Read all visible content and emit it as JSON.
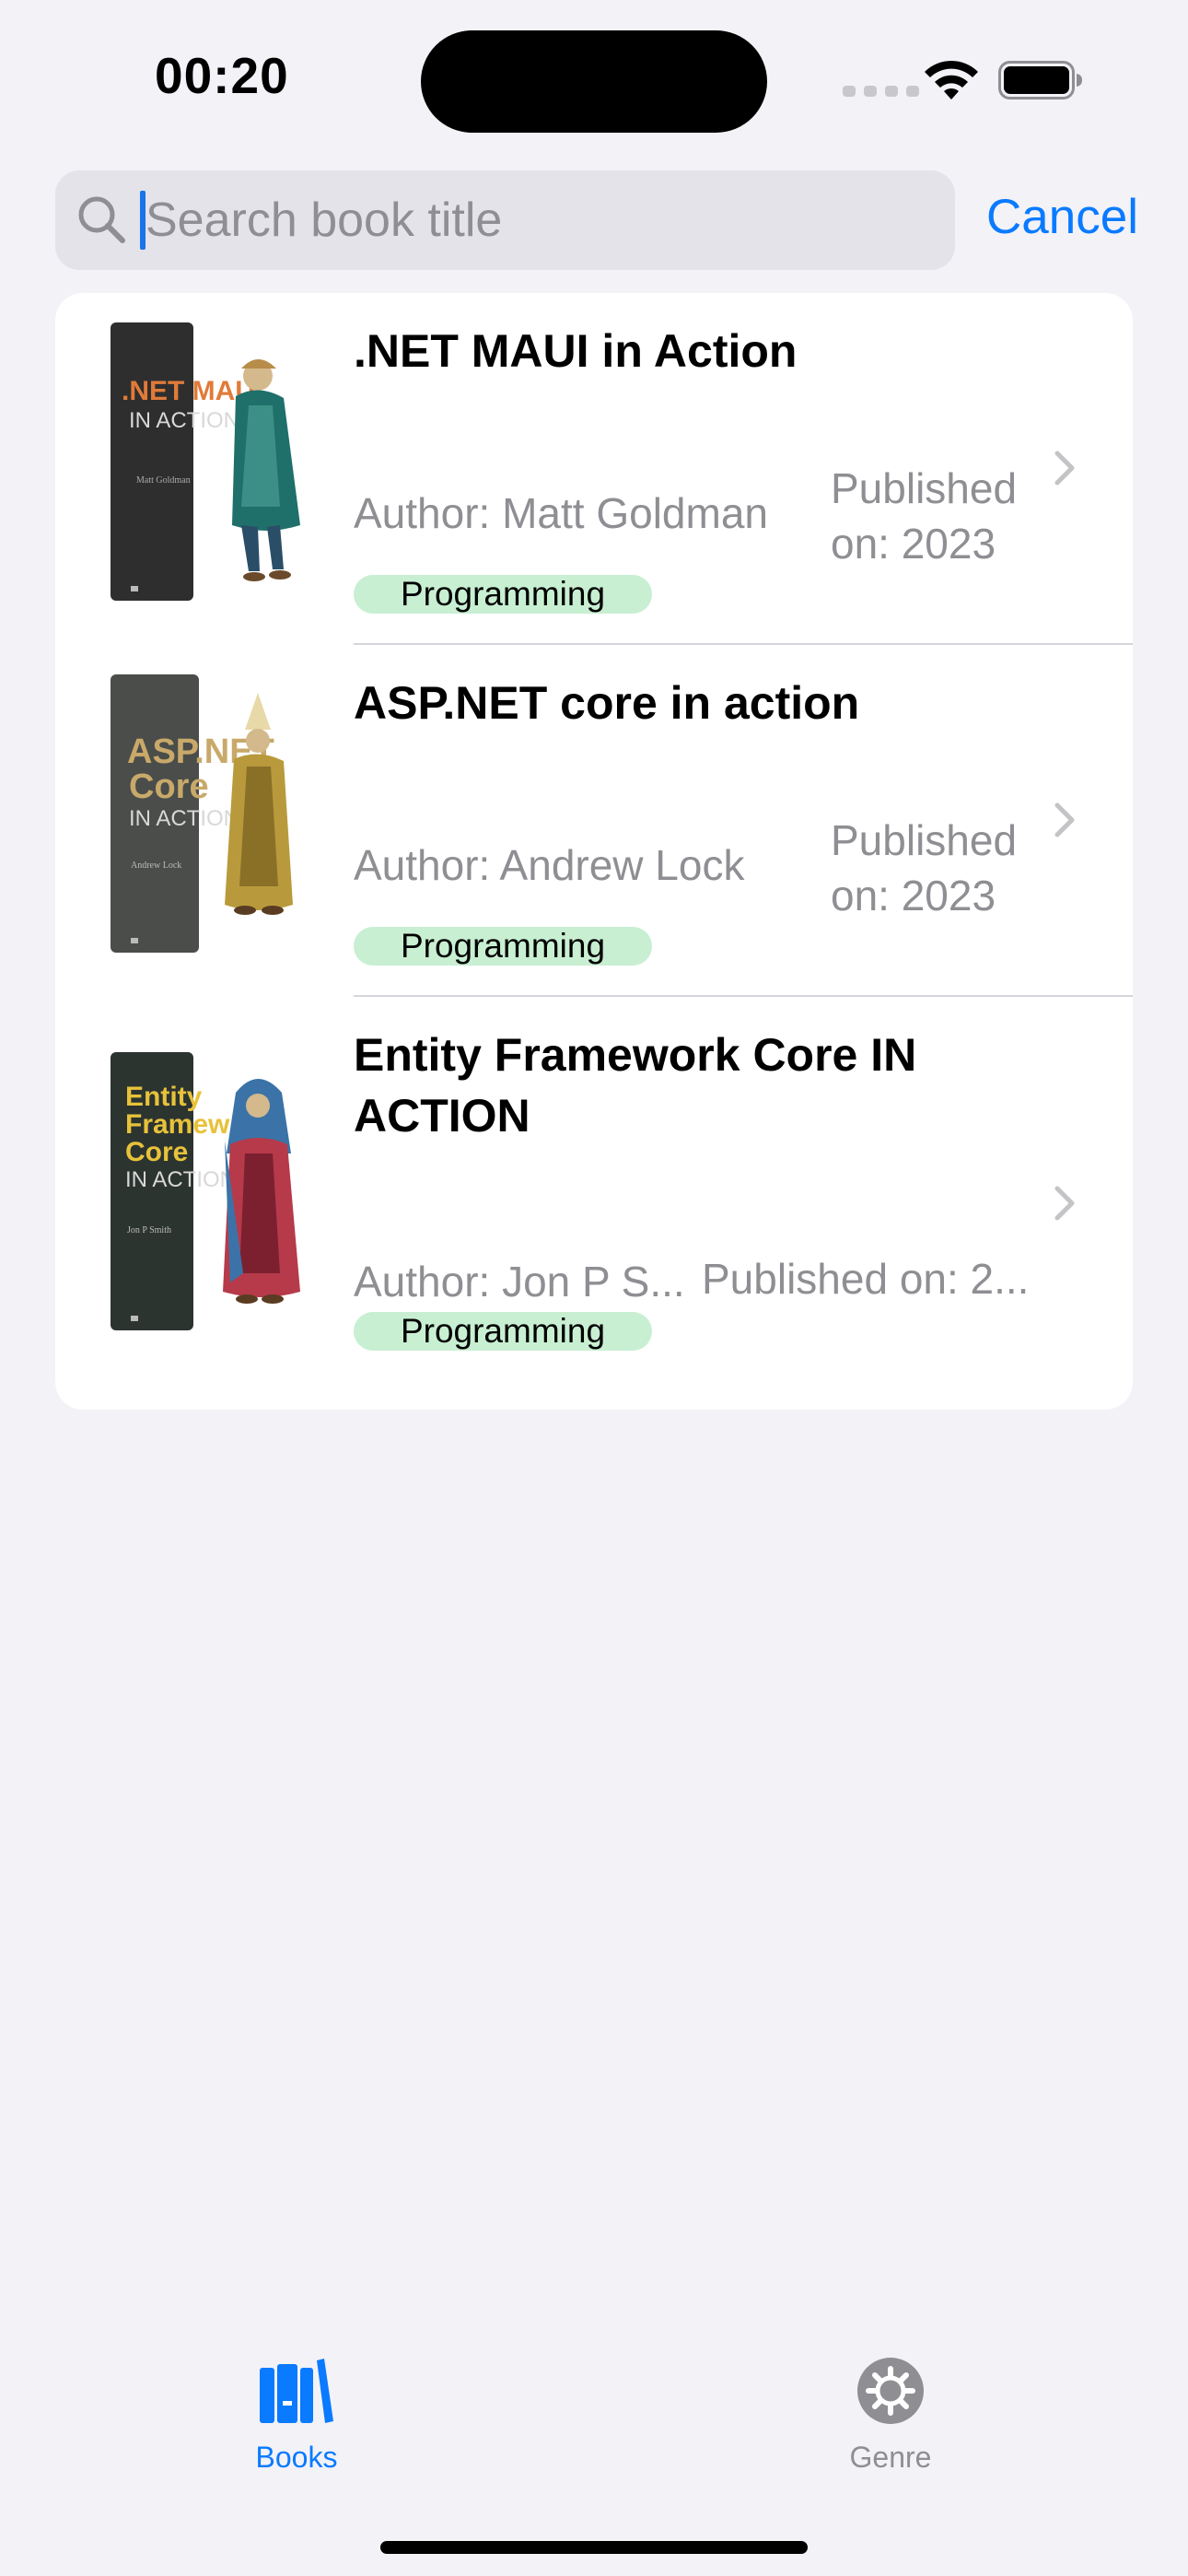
{
  "status_bar": {
    "time": "00:20"
  },
  "search": {
    "placeholder": "Search book title",
    "value": "",
    "cancel_label": "Cancel"
  },
  "books": [
    {
      "title": ".NET MAUI in Action",
      "author": "Author: Matt Goldman",
      "published": "Published on: 2023",
      "genre": "Programming",
      "cover": {
        "spine_color": "#2e2e2e",
        "title_lines": [
          ".NET MAUI",
          "IN ACTION"
        ],
        "title_color": "#e07b39",
        "author": "Matt Goldman"
      }
    },
    {
      "title": "ASP.NET core in action",
      "author": "Author: Andrew Lock",
      "published": "Published on: 2023",
      "genre": "Programming",
      "cover": {
        "spine_color": "#4a4d4a",
        "title_lines": [
          "ASP.NET",
          "Core",
          "IN ACTION"
        ],
        "title_color": "#c8a96a",
        "author": "Andrew Lock"
      }
    },
    {
      "title": "Entity Framework Core IN ACTION",
      "author": "Author: Jon P S...",
      "published": "Published on: 2...",
      "genre": "Programming",
      "cover": {
        "spine_color": "#2c3430",
        "title_lines": [
          "Entity",
          "Framework",
          "Core",
          "IN ACTION"
        ],
        "title_color": "#e7c23a",
        "author": "Jon P Smith"
      }
    }
  ],
  "tabs": [
    {
      "label": "Books",
      "icon": "books-icon",
      "active": true
    },
    {
      "label": "Genre",
      "icon": "gear-icon",
      "active": false
    }
  ],
  "colors": {
    "accent": "#0a7aff",
    "badge": "#c8efd2",
    "background": "#f2f2f7"
  }
}
